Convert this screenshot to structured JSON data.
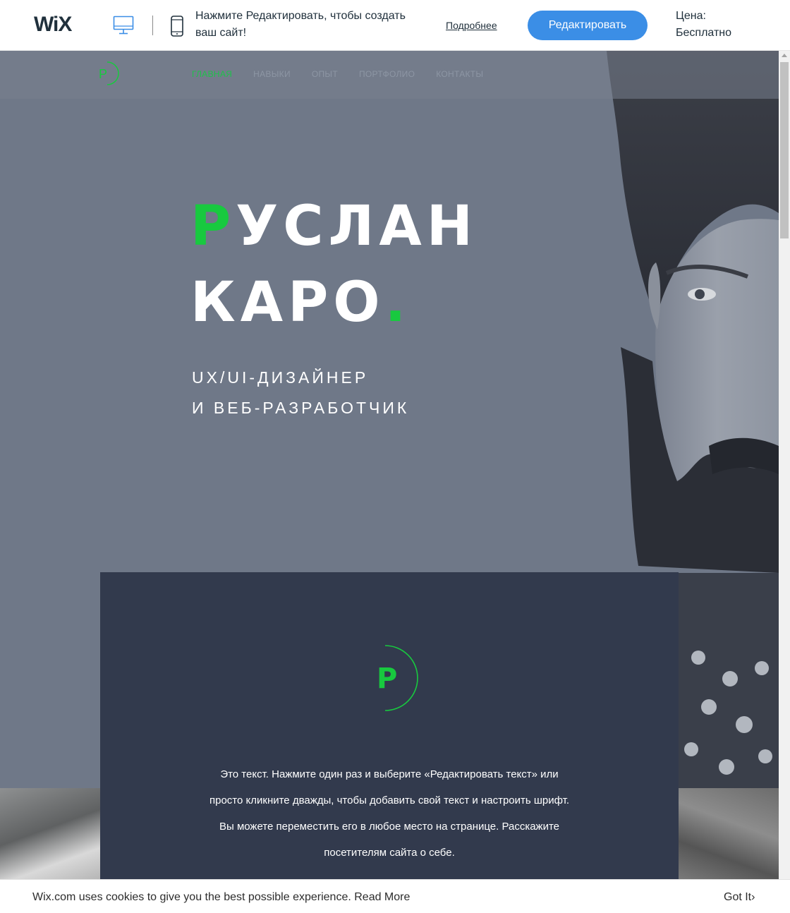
{
  "wix_bar": {
    "logo": "WiX",
    "promo_text": "Нажмите Редактировать, чтобы создать ваш сайт!",
    "more_link": "Подробнее",
    "edit_button": "Редактировать",
    "price_label": "Цена:",
    "price_value": "Бесплатно",
    "icons": [
      "desktop-icon",
      "mobile-icon"
    ]
  },
  "site": {
    "nav": {
      "items": [
        {
          "label": "ГЛАВНАЯ",
          "active": true
        },
        {
          "label": "НАВЫКИ",
          "active": false
        },
        {
          "label": "ОПЫТ",
          "active": false
        },
        {
          "label": "ПОРТФОЛИО",
          "active": false
        },
        {
          "label": "КОНТАКТЫ",
          "active": false
        }
      ]
    },
    "logo_letter": "P",
    "hero": {
      "name_first_letter": "Р",
      "name_rest": "УСЛАН",
      "surname": "КАРО",
      "surname_dot": ".",
      "role_line1": "UX/UI-ДИЗАЙНЕР",
      "role_line2": "И ВЕБ-РАЗРАБОТЧИК"
    },
    "about": {
      "logo_letter": "P",
      "text": "Это текст. Нажмите один раз и выберите «Редактировать текст» или просто кликните дважды, чтобы добавить свой текст и настроить шрифт. Вы можете переместить его в любое место на странице. Расскажите посетителям сайта о себе."
    }
  },
  "cookie_bar": {
    "text": "Wix.com uses cookies to give you the best possible experience.",
    "link": "Read More",
    "button": "Got It"
  },
  "colors": {
    "accent_green": "#18c93f",
    "wix_blue": "#3b8ee6",
    "hero_bg": "#6f7888",
    "card_bg": "#323a4d"
  }
}
